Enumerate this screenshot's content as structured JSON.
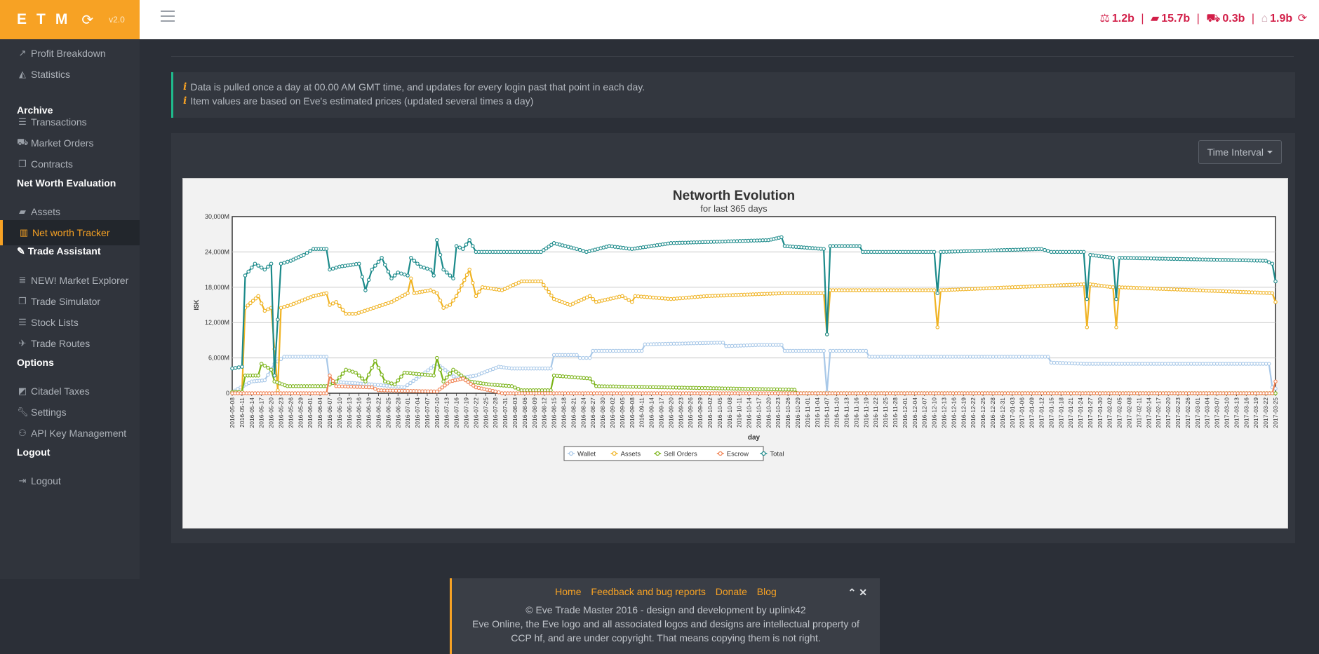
{
  "brand": {
    "logo": "ETM",
    "refresh_icon": "refresh-icon",
    "version": "v2.0"
  },
  "header": {
    "stats": [
      {
        "icon": "balance-scale-icon",
        "value": "1.2b"
      },
      {
        "icon": "briefcase-icon",
        "value": "15.7b"
      },
      {
        "icon": "shopping-cart-icon",
        "value": "0.3b"
      },
      {
        "icon": "bank-icon",
        "value": "1.9b"
      }
    ],
    "separator": "|",
    "refresh_icon": "refresh-icon"
  },
  "sidebar": {
    "items": [
      {
        "label": "Profit Breakdown",
        "icon": "line-chart-icon"
      },
      {
        "label": "Statistics",
        "icon": "area-chart-icon"
      },
      {
        "heading": "Archive"
      },
      {
        "label": "Transactions",
        "icon": "list-icon"
      },
      {
        "label": "Market Orders",
        "icon": "cart-icon"
      },
      {
        "label": "Contracts",
        "icon": "copy-icon"
      },
      {
        "heading": "Net Worth Evaluation"
      },
      {
        "label": "Assets",
        "icon": "briefcase-icon"
      },
      {
        "label": "Net worth Tracker",
        "icon": "bar-chart-icon",
        "active": true
      },
      {
        "heading": "Trade Assistant"
      },
      {
        "label": "NEW! Market Explorer",
        "icon": "database-icon"
      },
      {
        "label": "Trade Simulator",
        "icon": "copy-icon"
      },
      {
        "label": "Stock Lists",
        "icon": "list-icon"
      },
      {
        "label": "Trade Routes",
        "icon": "plane-icon"
      },
      {
        "heading": "Options"
      },
      {
        "label": "Citadel Taxes",
        "icon": "eraser-icon"
      },
      {
        "label": "Settings",
        "icon": "wrench-icon"
      },
      {
        "label": "API Key Management",
        "icon": "users-icon"
      },
      {
        "heading": "Logout"
      },
      {
        "label": "Logout",
        "icon": "sign-out-icon"
      }
    ]
  },
  "info": {
    "lines": [
      "Data is pulled once a day at 00.00 AM GMT time, and updates for every login past that point in each day.",
      "Item values are based on Eve's estimated prices (updated several times a day)"
    ]
  },
  "time_interval_label": "Time Interval",
  "chart_data": {
    "type": "line",
    "title": "Networth Evolution",
    "subtitle": "for last 365 days",
    "xlabel": "day",
    "ylabel": "ISK",
    "ylim": [
      0,
      30000000
    ],
    "y_ticks": [
      "0",
      "6,000M",
      "12,000M",
      "18,000M",
      "24,000M",
      "30,000M"
    ],
    "x_start": "2016-05-08",
    "x_end": "2017-03-25",
    "x_tick_step_days": 3,
    "grid": true,
    "legend_position": "bottom",
    "series_colors": {
      "Wallet": "#a8c8e8",
      "Assets": "#f0b323",
      "Sell Orders": "#7ab317",
      "Escrow": "#f08050",
      "Total": "#1b8a8a"
    },
    "series": [
      {
        "name": "Wallet",
        "points": [
          [
            "2016-05-08",
            0.2
          ],
          [
            "2016-05-14",
            2.0
          ],
          [
            "2016-05-18",
            2.2
          ],
          [
            "2016-05-21",
            5.0
          ],
          [
            "2016-05-24",
            6.2
          ],
          [
            "2016-06-06",
            6.2
          ],
          [
            "2016-06-07",
            2.0
          ],
          [
            "2016-06-20",
            1.5
          ],
          [
            "2016-06-30",
            1.0
          ],
          [
            "2016-07-10",
            5.0
          ],
          [
            "2016-07-16",
            2.5
          ],
          [
            "2016-07-22",
            3.0
          ],
          [
            "2016-07-29",
            4.5
          ],
          [
            "2016-08-02",
            4.2
          ],
          [
            "2016-08-14",
            4.2
          ],
          [
            "2016-08-15",
            6.5
          ],
          [
            "2016-08-22",
            6.5
          ],
          [
            "2016-08-23",
            6.0
          ],
          [
            "2016-08-26",
            6.0
          ],
          [
            "2016-08-27",
            7.2
          ],
          [
            "2016-09-11",
            7.2
          ],
          [
            "2016-09-12",
            8.3
          ],
          [
            "2016-10-06",
            8.6
          ],
          [
            "2016-10-07",
            8.0
          ],
          [
            "2016-10-17",
            8.2
          ],
          [
            "2016-10-24",
            8.2
          ],
          [
            "2016-10-25",
            7.2
          ],
          [
            "2016-11-06",
            7.2
          ],
          [
            "2016-11-07",
            0.2
          ],
          [
            "2016-11-08",
            7.2
          ],
          [
            "2016-11-19",
            7.2
          ],
          [
            "2016-11-20",
            6.2
          ],
          [
            "2017-01-14",
            6.2
          ],
          [
            "2017-01-15",
            5.2
          ],
          [
            "2017-01-25",
            5.0
          ],
          [
            "2017-02-04",
            5.0
          ],
          [
            "2017-03-23",
            5.0
          ],
          [
            "2017-03-24",
            1.0
          ],
          [
            "2017-03-25",
            0.8
          ]
        ]
      },
      {
        "name": "Assets",
        "points": [
          [
            "2016-05-08",
            0.2
          ],
          [
            "2016-05-11",
            0.2
          ],
          [
            "2016-05-12",
            14.5
          ],
          [
            "2016-05-16",
            16.5
          ],
          [
            "2016-05-18",
            14.0
          ],
          [
            "2016-05-20",
            14.5
          ],
          [
            "2016-05-22",
            0.5
          ],
          [
            "2016-05-23",
            14.5
          ],
          [
            "2016-05-26",
            15.0
          ],
          [
            "2016-06-02",
            16.5
          ],
          [
            "2016-06-06",
            17.0
          ],
          [
            "2016-06-07",
            15.0
          ],
          [
            "2016-06-09",
            15.5
          ],
          [
            "2016-06-12",
            13.5
          ],
          [
            "2016-06-15",
            13.5
          ],
          [
            "2016-06-26",
            15.5
          ],
          [
            "2016-07-01",
            17.0
          ],
          [
            "2016-07-02",
            19.5
          ],
          [
            "2016-07-03",
            17.0
          ],
          [
            "2016-07-08",
            17.5
          ],
          [
            "2016-07-10",
            17.0
          ],
          [
            "2016-07-12",
            14.5
          ],
          [
            "2016-07-14",
            15.0
          ],
          [
            "2016-07-16",
            16.5
          ],
          [
            "2016-07-20",
            21.0
          ],
          [
            "2016-07-22",
            16.5
          ],
          [
            "2016-07-24",
            18.0
          ],
          [
            "2016-07-30",
            17.5
          ],
          [
            "2016-08-05",
            19.0
          ],
          [
            "2016-08-11",
            19.0
          ],
          [
            "2016-08-15",
            16.0
          ],
          [
            "2016-08-20",
            15.0
          ],
          [
            "2016-08-26",
            16.5
          ],
          [
            "2016-08-28",
            15.5
          ],
          [
            "2016-09-05",
            16.5
          ],
          [
            "2016-09-08",
            15.5
          ],
          [
            "2016-09-09",
            16.5
          ],
          [
            "2016-09-20",
            16.0
          ],
          [
            "2016-10-01",
            16.5
          ],
          [
            "2016-10-25",
            17.0
          ],
          [
            "2016-11-06",
            17.0
          ],
          [
            "2016-11-07",
            10.0
          ],
          [
            "2016-11-08",
            17.5
          ],
          [
            "2016-12-10",
            17.5
          ],
          [
            "2016-12-11",
            11.2
          ],
          [
            "2016-12-12",
            17.5
          ],
          [
            "2017-01-25",
            18.5
          ],
          [
            "2017-01-26",
            11.2
          ],
          [
            "2017-01-27",
            18.5
          ],
          [
            "2017-02-03",
            18.0
          ],
          [
            "2017-02-04",
            11.2
          ],
          [
            "2017-02-05",
            18.0
          ],
          [
            "2017-03-24",
            17.0
          ],
          [
            "2017-03-25",
            15.5
          ]
        ]
      },
      {
        "name": "Sell Orders",
        "points": [
          [
            "2016-05-08",
            0.2
          ],
          [
            "2016-05-11",
            0.2
          ],
          [
            "2016-05-12",
            3.0
          ],
          [
            "2016-05-16",
            3.0
          ],
          [
            "2016-05-17",
            5.0
          ],
          [
            "2016-05-20",
            4.0
          ],
          [
            "2016-05-21",
            2.0
          ],
          [
            "2016-05-25",
            1.2
          ],
          [
            "2016-06-06",
            1.2
          ],
          [
            "2016-06-09",
            2.0
          ],
          [
            "2016-06-12",
            4.0
          ],
          [
            "2016-06-15",
            3.5
          ],
          [
            "2016-06-18",
            2.0
          ],
          [
            "2016-06-21",
            5.5
          ],
          [
            "2016-06-24",
            2.0
          ],
          [
            "2016-06-27",
            1.5
          ],
          [
            "2016-06-30",
            3.5
          ],
          [
            "2016-07-09",
            3.0
          ],
          [
            "2016-07-10",
            6.0
          ],
          [
            "2016-07-12",
            2.0
          ],
          [
            "2016-07-15",
            4.0
          ],
          [
            "2016-07-20",
            2.0
          ],
          [
            "2016-07-26",
            1.5
          ],
          [
            "2016-08-02",
            1.2
          ],
          [
            "2016-08-05",
            0.5
          ],
          [
            "2016-08-14",
            0.5
          ],
          [
            "2016-08-15",
            3.0
          ],
          [
            "2016-08-26",
            2.5
          ],
          [
            "2016-08-28",
            1.2
          ],
          [
            "2016-09-18",
            1.0
          ],
          [
            "2016-10-28",
            0.6
          ],
          [
            "2016-10-29",
            0.0
          ],
          [
            "2017-03-25",
            0.0
          ]
        ]
      },
      {
        "name": "Escrow",
        "points": [
          [
            "2016-05-08",
            0.0
          ],
          [
            "2016-06-06",
            0.0
          ],
          [
            "2016-06-07",
            3.0
          ],
          [
            "2016-06-09",
            1.2
          ],
          [
            "2016-06-20",
            1.0
          ],
          [
            "2016-06-22",
            0.5
          ],
          [
            "2016-07-10",
            0.3
          ],
          [
            "2016-07-14",
            2.0
          ],
          [
            "2016-07-18",
            2.5
          ],
          [
            "2016-07-22",
            1.0
          ],
          [
            "2016-07-28",
            0.3
          ],
          [
            "2016-07-30",
            0.0
          ],
          [
            "2017-03-24",
            0.0
          ],
          [
            "2017-03-25",
            2.0
          ]
        ]
      },
      {
        "name": "Total",
        "points": [
          [
            "2016-05-08",
            4.2
          ],
          [
            "2016-05-11",
            4.5
          ],
          [
            "2016-05-12",
            20.0
          ],
          [
            "2016-05-15",
            22.0
          ],
          [
            "2016-05-18",
            21.0
          ],
          [
            "2016-05-20",
            22.0
          ],
          [
            "2016-05-21",
            3.0
          ],
          [
            "2016-05-23",
            22.0
          ],
          [
            "2016-05-26",
            22.5
          ],
          [
            "2016-05-30",
            23.5
          ],
          [
            "2016-06-02",
            24.5
          ],
          [
            "2016-06-06",
            24.5
          ],
          [
            "2016-06-07",
            21.0
          ],
          [
            "2016-06-10",
            21.5
          ],
          [
            "2016-06-16",
            22.0
          ],
          [
            "2016-06-18",
            17.5
          ],
          [
            "2016-06-20",
            21.0
          ],
          [
            "2016-06-23",
            23.0
          ],
          [
            "2016-06-26",
            19.5
          ],
          [
            "2016-06-28",
            20.5
          ],
          [
            "2016-07-01",
            20.0
          ],
          [
            "2016-07-02",
            23.0
          ],
          [
            "2016-07-05",
            21.5
          ],
          [
            "2016-07-08",
            21.0
          ],
          [
            "2016-07-09",
            20.0
          ],
          [
            "2016-07-10",
            26.0
          ],
          [
            "2016-07-12",
            21.0
          ],
          [
            "2016-07-15",
            19.5
          ],
          [
            "2016-07-16",
            25.0
          ],
          [
            "2016-07-18",
            24.5
          ],
          [
            "2016-07-20",
            26.0
          ],
          [
            "2016-07-22",
            24.0
          ],
          [
            "2016-07-28",
            24.0
          ],
          [
            "2016-08-04",
            24.0
          ],
          [
            "2016-08-11",
            24.0
          ],
          [
            "2016-08-15",
            25.5
          ],
          [
            "2016-08-22",
            24.5
          ],
          [
            "2016-08-25",
            24.0
          ],
          [
            "2016-09-01",
            25.0
          ],
          [
            "2016-09-08",
            24.5
          ],
          [
            "2016-09-20",
            25.5
          ],
          [
            "2016-10-20",
            26.0
          ],
          [
            "2016-10-24",
            26.5
          ],
          [
            "2016-10-25",
            25.0
          ],
          [
            "2016-11-06",
            24.5
          ],
          [
            "2016-11-07",
            10.0
          ],
          [
            "2016-11-08",
            25.0
          ],
          [
            "2016-11-17",
            25.0
          ],
          [
            "2016-11-18",
            24.0
          ],
          [
            "2016-12-10",
            24.0
          ],
          [
            "2016-12-11",
            17.0
          ],
          [
            "2016-12-12",
            24.0
          ],
          [
            "2017-01-12",
            24.5
          ],
          [
            "2017-01-15",
            24.0
          ],
          [
            "2017-01-25",
            24.0
          ],
          [
            "2017-01-26",
            16.0
          ],
          [
            "2017-01-27",
            23.5
          ],
          [
            "2017-02-03",
            23.0
          ],
          [
            "2017-02-04",
            16.0
          ],
          [
            "2017-02-05",
            23.0
          ],
          [
            "2017-03-22",
            22.5
          ],
          [
            "2017-03-24",
            22.0
          ],
          [
            "2017-03-25",
            19.0
          ]
        ]
      }
    ],
    "legend_icon": "circle-marker-icon"
  },
  "footer": {
    "links": [
      "Home",
      "Feedback and bug reports",
      "Donate",
      "Blog"
    ],
    "copyright": "© Eve Trade Master 2016 - design and development by uplink42",
    "legal": "Eve Online, the Eve logo and all associated logos and designs are intellectual property of CCP hf, and are under copyright. That means copying them is not right.",
    "collapse_icon": "chevron-up-icon",
    "close_icon": "close-icon"
  }
}
